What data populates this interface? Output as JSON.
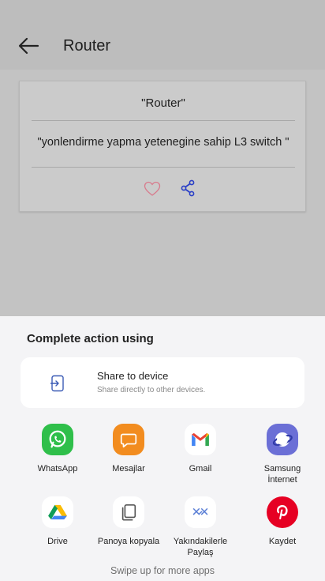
{
  "app": {
    "title": "Router",
    "card_title": "\"Router\"",
    "card_body": "\"yonlendirme yapma yetenegine sahip L3 switch \"",
    "icons": [
      "back-arrow-icon",
      "heart-icon",
      "share-icon"
    ]
  },
  "sheet": {
    "title": "Complete action using",
    "device": {
      "title": "Share to device",
      "subtitle": "Share directly to other devices.",
      "icon": "share-to-device-icon"
    },
    "apps": [
      {
        "label": "WhatsApp",
        "icon": "whatsapp-icon",
        "color": "#2fbf4a"
      },
      {
        "label": "Mesajlar",
        "icon": "messages-icon",
        "color": "#f28c1f"
      },
      {
        "label": "Gmail",
        "icon": "gmail-icon",
        "color": "#ffffff"
      },
      {
        "label": "Samsung\nİnternet",
        "icon": "samsung-internet-icon",
        "color": "#6b6fd6"
      },
      {
        "label": "Drive",
        "icon": "drive-icon",
        "color": "#ffffff"
      },
      {
        "label": "Panoya kopyala",
        "icon": "copy-icon",
        "color": "#ffffff"
      },
      {
        "label": "Yakındakilerle\nPaylaş",
        "icon": "nearby-share-icon",
        "color": "#ffffff"
      },
      {
        "label": "Kaydet",
        "icon": "pinterest-icon",
        "color": "#e60023"
      }
    ],
    "swipe_hint": "Swipe up for more apps"
  }
}
